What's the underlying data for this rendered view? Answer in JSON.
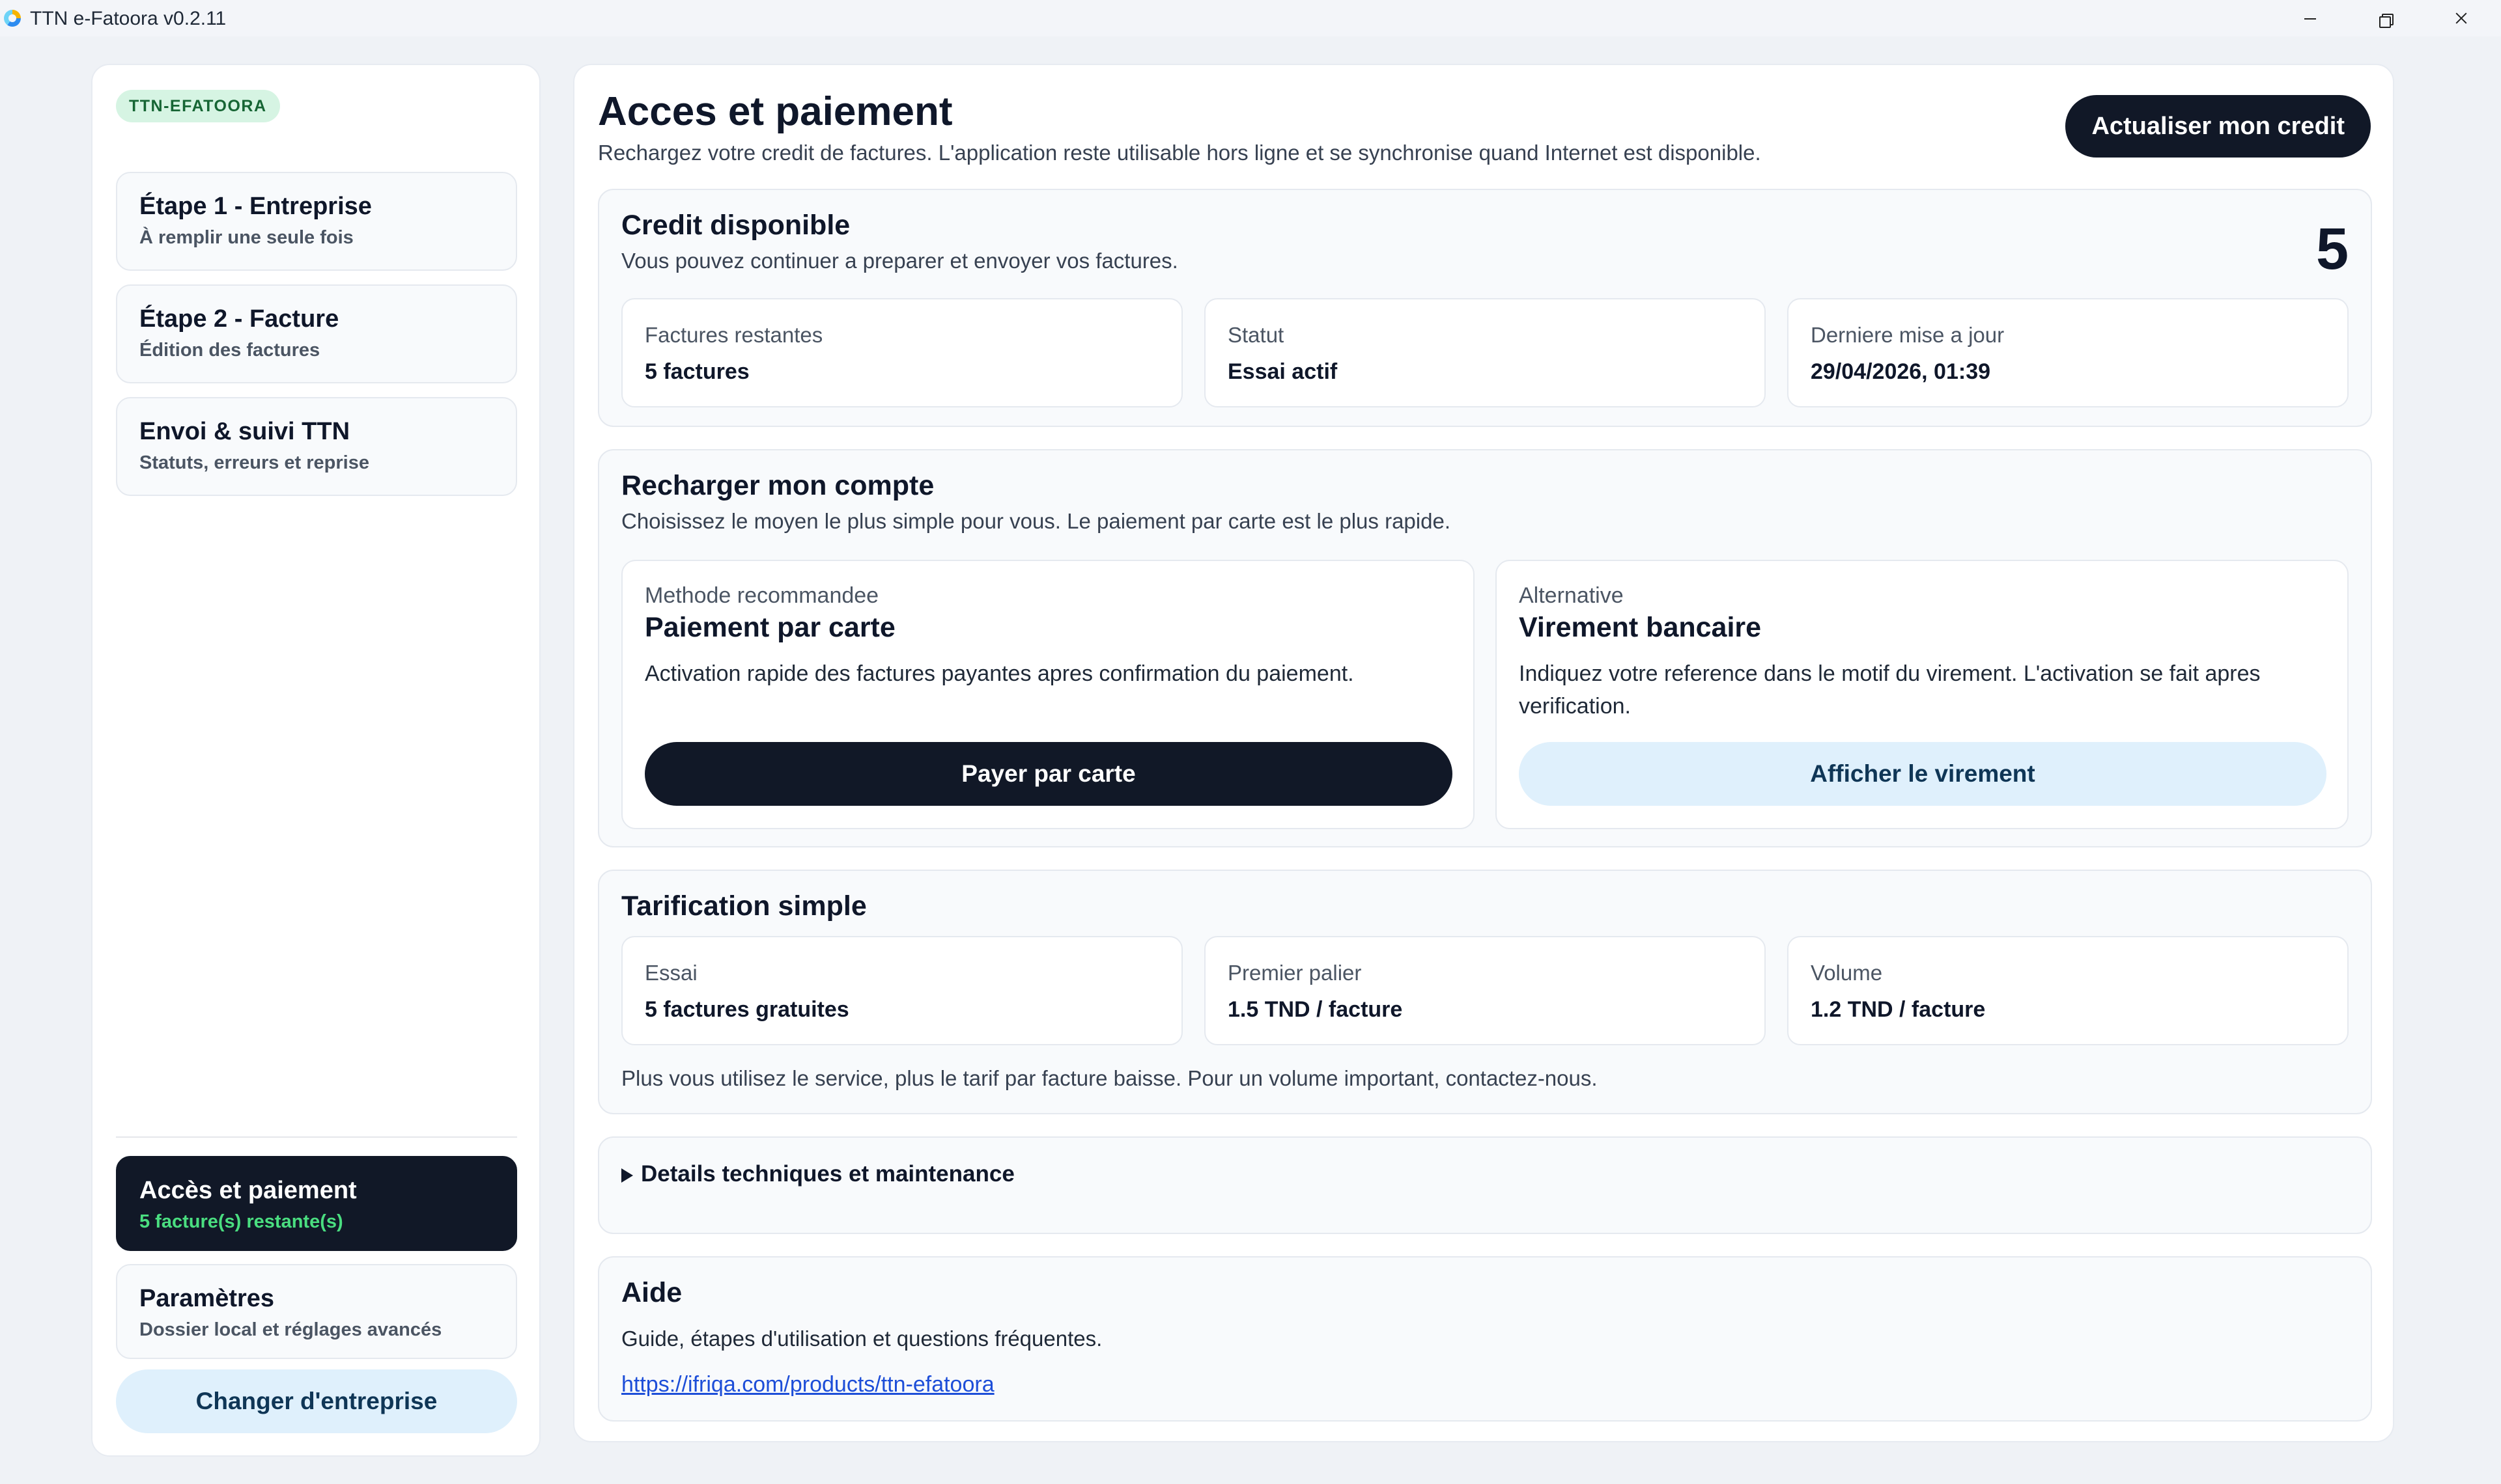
{
  "window": {
    "title": "TTN e-Fatoora v0.2.11"
  },
  "sidebar": {
    "brand": "TTN-EFATOORA",
    "steps": [
      {
        "title": "Étape 1 - Entreprise",
        "subtitle": "À remplir une seule fois"
      },
      {
        "title": "Étape 2 - Facture",
        "subtitle": "Édition des factures"
      },
      {
        "title": "Envoi & suivi TTN",
        "subtitle": "Statuts, erreurs et reprise"
      }
    ],
    "access": {
      "title": "Accès et paiement",
      "subtitle": "5 facture(s) restante(s)"
    },
    "settings": {
      "title": "Paramètres",
      "subtitle": "Dossier local et réglages avancés"
    },
    "change_company": "Changer d'entreprise"
  },
  "main": {
    "title": "Acces et paiement",
    "subtitle": "Rechargez votre credit de factures. L'application reste utilisable hors ligne et se synchronise quand Internet est disponible.",
    "refresh_button": "Actualiser mon credit",
    "credit": {
      "title": "Credit disponible",
      "subtitle": "Vous pouvez continuer a preparer et envoyer vos factures.",
      "count": "5",
      "stats": [
        {
          "label": "Factures restantes",
          "value": "5 factures"
        },
        {
          "label": "Statut",
          "value": "Essai actif"
        },
        {
          "label": "Derniere mise a jour",
          "value": "29/04/2026, 01:39"
        }
      ]
    },
    "recharge": {
      "title": "Recharger mon compte",
      "subtitle": "Choisissez le moyen le plus simple pour vous. Le paiement par carte est le plus rapide.",
      "card": {
        "kicker": "Methode recommandee",
        "name": "Paiement par carte",
        "description": "Activation rapide des factures payantes apres confirmation du paiement.",
        "button": "Payer par carte"
      },
      "transfer": {
        "kicker": "Alternative",
        "name": "Virement bancaire",
        "description": "Indiquez votre reference dans le motif du virement. L'activation se fait apres verification.",
        "button": "Afficher le virement"
      }
    },
    "pricing": {
      "title": "Tarification simple",
      "tiers": [
        {
          "label": "Essai",
          "value": "5 factures gratuites"
        },
        {
          "label": "Premier palier",
          "value": "1.5 TND / facture"
        },
        {
          "label": "Volume",
          "value": "1.2 TND / facture"
        }
      ],
      "note": "Plus vous utilisez le service, plus le tarif par facture baisse. Pour un volume important, contactez-nous."
    },
    "details": {
      "summary": "Details techniques et maintenance"
    },
    "help": {
      "title": "Aide",
      "subtitle": "Guide, étapes d'utilisation et questions fréquentes.",
      "link": "https://ifriqa.com/products/ttn-efatoora"
    }
  }
}
